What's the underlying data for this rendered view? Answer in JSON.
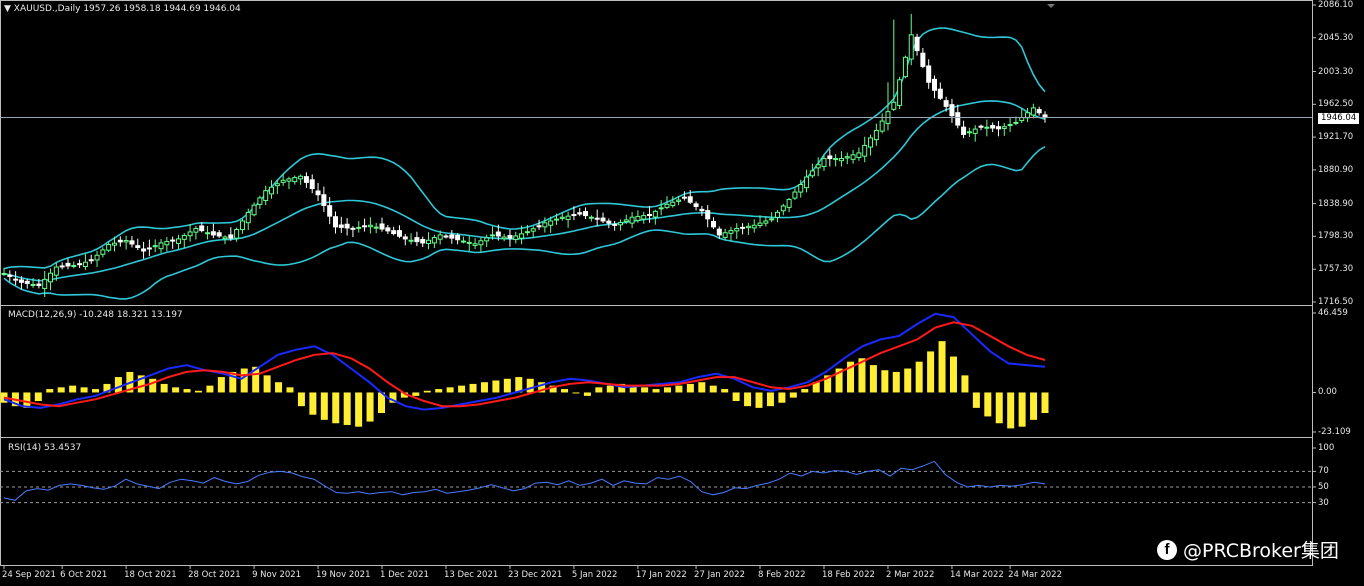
{
  "colors": {
    "background": "#000000",
    "bullish": "#66ff88",
    "bearish": "#ffffff",
    "bollinger": "#2ec7d6",
    "macd_line": "#1a2aff",
    "signal_line": "#ff1a1a",
    "histogram": "#ffee33",
    "rsi": "#4a7cff",
    "grid_level": "#9a9a9a",
    "axis": "#bdbdbd"
  },
  "header": {
    "symbol": "XAUUSD.,Daily",
    "ohlc": "1957.26 1958.18 1944.69 1946.04"
  },
  "macd_panel": {
    "label": "MACD(12,26,9) -10.248 18.321 13.197"
  },
  "rsi_panel": {
    "label": "RSI(14) 53.4537"
  },
  "current_price": "1946.04",
  "watermark": {
    "text": "@PRCBroker集团",
    "icon": "facebook-icon",
    "icon_glyph": "f"
  },
  "chart_data": [
    {
      "type": "candlestick",
      "title": "XAUUSD.,Daily",
      "ylim": [
        1716.5,
        2086.1
      ],
      "yticks": [
        "2086.10",
        "2045.30",
        "2003.30",
        "1962.50",
        "1921.70",
        "1880.90",
        "1838.90",
        "1798.30",
        "1757.30",
        "1716.50"
      ],
      "ytick_values": [
        2086.1,
        2045.3,
        2003.3,
        1962.5,
        1921.7,
        1880.9,
        1838.9,
        1798.3,
        1757.3,
        1716.5
      ],
      "current": 1946.04,
      "bollinger": {
        "upper": true,
        "middle": true,
        "lower": true
      },
      "close_path": [
        [
          0,
          1752
        ],
        [
          3,
          1741
        ],
        [
          6,
          1737
        ],
        [
          9,
          1760
        ],
        [
          12,
          1762
        ],
        [
          15,
          1768
        ],
        [
          18,
          1788
        ],
        [
          21,
          1793
        ],
        [
          24,
          1780
        ],
        [
          27,
          1790
        ],
        [
          30,
          1795
        ],
        [
          33,
          1808
        ],
        [
          36,
          1800
        ],
        [
          39,
          1796
        ],
        [
          42,
          1828
        ],
        [
          45,
          1855
        ],
        [
          48,
          1868
        ],
        [
          51,
          1873
        ],
        [
          54,
          1850
        ],
        [
          57,
          1810
        ],
        [
          60,
          1808
        ],
        [
          63,
          1812
        ],
        [
          66,
          1805
        ],
        [
          69,
          1795
        ],
        [
          72,
          1790
        ],
        [
          75,
          1800
        ],
        [
          78,
          1794
        ],
        [
          81,
          1789
        ],
        [
          84,
          1800
        ],
        [
          87,
          1796
        ],
        [
          90,
          1804
        ],
        [
          93,
          1815
        ],
        [
          96,
          1822
        ],
        [
          99,
          1826
        ],
        [
          102,
          1820
        ],
        [
          105,
          1812
        ],
        [
          108,
          1822
        ],
        [
          111,
          1825
        ],
        [
          114,
          1838
        ],
        [
          117,
          1846
        ],
        [
          120,
          1830
        ],
        [
          123,
          1800
        ],
        [
          126,
          1808
        ],
        [
          129,
          1812
        ],
        [
          132,
          1820
        ],
        [
          135,
          1844
        ],
        [
          138,
          1872
        ],
        [
          141,
          1895
        ],
        [
          144,
          1895
        ],
        [
          147,
          1902
        ],
        [
          150,
          1930
        ],
        [
          153,
          1965
        ],
        [
          156,
          2049
        ],
        [
          159,
          1990
        ],
        [
          162,
          1960
        ],
        [
          165,
          1925
        ],
        [
          168,
          1935
        ],
        [
          171,
          1932
        ],
        [
          174,
          1940
        ],
        [
          177,
          1958
        ],
        [
          179,
          1946
        ]
      ],
      "xlabels": [
        "24 Sep 2021",
        "6 Oct 2021",
        "18 Oct 2021",
        "28 Oct 2021",
        "9 Nov 2021",
        "19 Nov 2021",
        "1 Dec 2021",
        "13 Dec 2021",
        "23 Dec 2021",
        "5 Jan 2022",
        "17 Jan 2022",
        "27 Jan 2022",
        "8 Feb 2022",
        "18 Feb 2022",
        "2 Mar 2022",
        "14 Mar 2022",
        "24 Mar 2022"
      ],
      "xlabel_bars": [
        0,
        10,
        21,
        32,
        43,
        54,
        65,
        76,
        87,
        98,
        109,
        119,
        130,
        141,
        152,
        163,
        173
      ]
    },
    {
      "type": "line",
      "title": "MACD(12,26,9)",
      "ylim": [
        -23.109,
        46.459
      ],
      "yticks": [
        "46.459",
        "0.00",
        "-23.109"
      ],
      "ytick_values": [
        46.459,
        0,
        -23.109
      ],
      "series": [
        {
          "name": "MACD",
          "values": [
            -4,
            -8,
            -9,
            -7,
            -4,
            -2,
            2,
            6,
            10,
            14,
            16,
            13,
            11,
            8,
            15,
            22,
            25,
            27,
            22,
            14,
            6,
            -3,
            -8,
            -10,
            -9,
            -7,
            -5,
            -3,
            0,
            3,
            6,
            8,
            7,
            5,
            3,
            4,
            5,
            6,
            9,
            11,
            8,
            3,
            1,
            3,
            6,
            12,
            20,
            27,
            31,
            33,
            40,
            46,
            44,
            34,
            24,
            17,
            16,
            15
          ]
        },
        {
          "name": "Signal",
          "values": [
            -3,
            -5,
            -7,
            -8,
            -6,
            -4,
            -1,
            2,
            5,
            9,
            12,
            13,
            12,
            10,
            11,
            15,
            19,
            22,
            23,
            20,
            14,
            6,
            -1,
            -5,
            -8,
            -8,
            -7,
            -5,
            -3,
            0,
            3,
            5,
            6,
            5,
            4,
            4,
            4,
            5,
            7,
            9,
            9,
            6,
            3,
            2,
            4,
            8,
            13,
            18,
            23,
            27,
            31,
            38,
            41,
            39,
            33,
            27,
            22,
            19
          ]
        }
      ],
      "histogram": [
        -6,
        -8,
        -9,
        -5,
        2,
        3,
        4,
        3,
        2,
        5,
        9,
        12,
        10,
        8,
        5,
        3,
        2,
        1,
        4,
        9,
        12,
        14,
        15,
        10,
        6,
        3,
        -8,
        -13,
        -16,
        -18,
        -19,
        -20,
        -17,
        -12,
        -6,
        -3,
        -2,
        1,
        2,
        3,
        4,
        5,
        6,
        7,
        8,
        9,
        8,
        6,
        4,
        2,
        0,
        -2,
        3,
        4,
        5,
        4,
        3,
        2,
        3,
        4,
        5,
        6,
        4,
        2,
        -5,
        -8,
        -9,
        -8,
        -6,
        -3,
        2,
        6,
        10,
        14,
        18,
        20,
        16,
        13,
        12,
        14,
        18,
        24,
        30,
        21,
        10,
        -9,
        -14,
        -18,
        -21,
        -20,
        -16,
        -12
      ]
    },
    {
      "type": "line",
      "title": "RSI(14)",
      "ylim": [
        0,
        100
      ],
      "yticks": [
        "100",
        "70",
        "50",
        "30"
      ],
      "ytick_values": [
        100,
        70,
        50,
        30
      ],
      "levels": [
        70,
        50,
        30
      ],
      "series": [
        {
          "name": "RSI",
          "values": [
            36,
            33,
            45,
            48,
            46,
            52,
            54,
            52,
            49,
            47,
            51,
            60,
            54,
            51,
            48,
            56,
            60,
            58,
            55,
            62,
            57,
            54,
            57,
            65,
            69,
            70,
            68,
            63,
            60,
            51,
            43,
            42,
            44,
            41,
            43,
            44,
            40,
            43,
            44,
            47,
            42,
            44,
            46,
            49,
            53,
            49,
            45,
            48,
            55,
            56,
            53,
            58,
            52,
            55,
            60,
            52,
            58,
            55,
            54,
            62,
            60,
            64,
            57,
            44,
            40,
            43,
            49,
            48,
            52,
            55,
            60,
            68,
            64,
            70,
            68,
            71,
            70,
            66,
            70,
            72,
            64,
            74,
            72,
            77,
            83,
            66,
            56,
            50,
            52,
            50,
            52,
            51,
            53,
            56,
            54
          ]
        }
      ]
    }
  ]
}
